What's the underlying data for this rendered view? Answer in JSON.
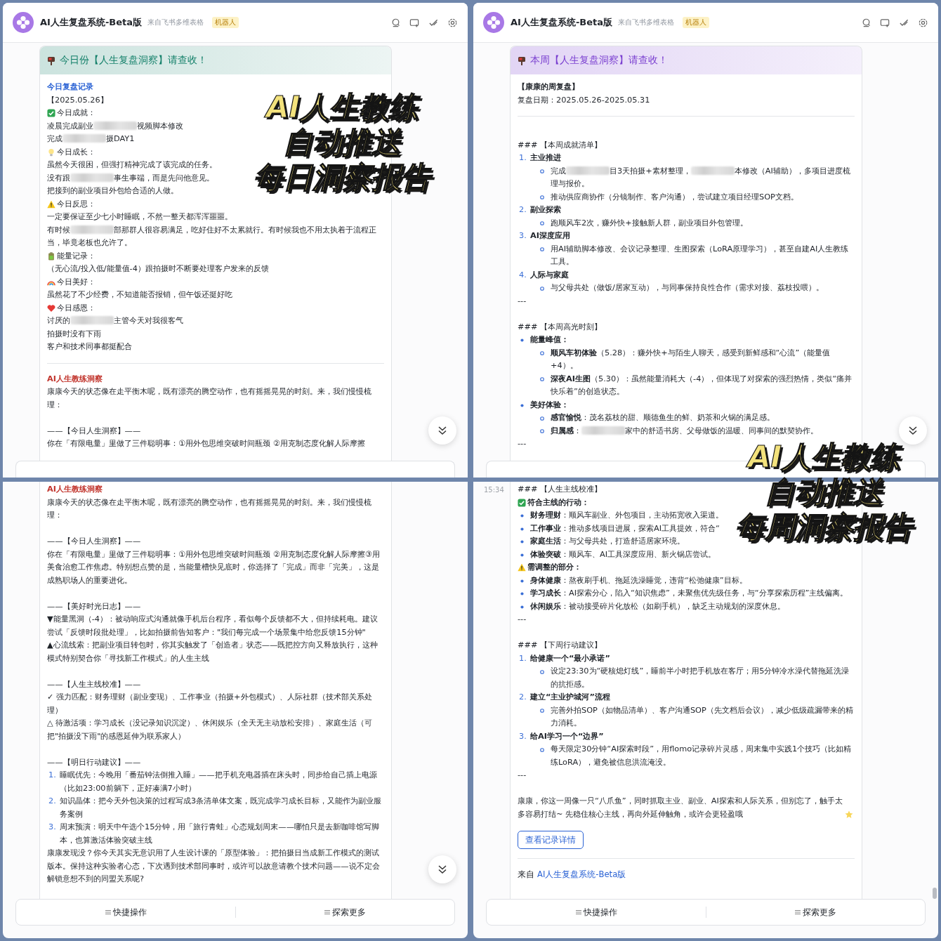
{
  "overlays": [
    {
      "lines": [
        "AI人生教练",
        "自动推送",
        "每日洞察报告"
      ]
    },
    {
      "lines": [
        "AI人生教练",
        "自动推送",
        "每周洞察报告"
      ]
    }
  ],
  "panels": [
    {
      "header": {
        "title": "AI人生复盘系统-Beta版",
        "source": "来自飞书多维表格",
        "badge": "机器人"
      },
      "card": {
        "title": "今日份【人生复盘洞察】请查收！",
        "color": "#14806a",
        "blocks": [
          {
            "kind": "section",
            "color": "#2a62d4",
            "text": "今日复盘记录"
          },
          {
            "kind": "text",
            "text": "【2025.05.26】"
          },
          {
            "kind": "check_label",
            "emphasis": false,
            "text": "今日成就："
          },
          {
            "kind": "text",
            "parts": [
              "凌晨完成副业",
              "视频脚本修改"
            ]
          },
          {
            "kind": "text",
            "parts": [
              "完成",
              "摄DAY1"
            ]
          },
          {
            "kind": "bulb_label",
            "emphasis": false,
            "text": "今日成长："
          },
          {
            "kind": "text",
            "text": "虽然今天很困，但强打精神完成了该完成的任务。"
          },
          {
            "kind": "text",
            "parts": [
              "没有跟",
              "事生事端，而是先问他意见。"
            ]
          },
          {
            "kind": "text",
            "text": "把接到的副业项目外包给合适的人做。"
          },
          {
            "kind": "warn_label",
            "emphasis": false,
            "text": "今日反思："
          },
          {
            "kind": "text",
            "text": "一定要保证至少七小时睡眠，不然一整天都浑浑噩噩。"
          },
          {
            "kind": "text",
            "parts": [
              "有时候",
              "部那群人很容易满足，吃好住好不太累就行。有时候我也不用太执着于流程正当，毕竟老板也允许了。"
            ]
          },
          {
            "kind": "battery_label",
            "emphasis": false,
            "text": "能量记录："
          },
          {
            "kind": "text",
            "text": "（无心流/投入低/能量值-4）跟拍摄时不断要处理客户发来的反馈"
          },
          {
            "kind": "rainbow_label",
            "emphasis": false,
            "text": "今日美好："
          },
          {
            "kind": "text",
            "text": "虽然花了不少经费，不知道能否报销，但午饭还挺好吃"
          },
          {
            "kind": "heart_label",
            "emphasis": false,
            "text": "今日感恩："
          },
          {
            "kind": "text",
            "parts": [
              "讨厌的",
              "主管今天对我很客气"
            ]
          },
          {
            "kind": "text",
            "text": "拍摄时没有下雨"
          },
          {
            "kind": "text",
            "text": "客户和技术同事都挺配合"
          },
          {
            "kind": "rule"
          },
          {
            "kind": "section",
            "color": "#c1332b",
            "text": "AI人生教练洞察"
          },
          {
            "kind": "text",
            "text": "康康今天的状态像在走平衡木呢，既有漂亮的腾空动作，也有摇摇晃晃的时刻。来，我们慢慢梳理："
          },
          {
            "kind": "blank"
          },
          {
            "kind": "text",
            "text": "——【今日人生洞察】——"
          },
          {
            "kind": "text",
            "text": "你在「有限电量」里做了三件聪明事：①用外包思维突破时间瓶颈 ②用克制态度化解人际摩擦"
          }
        ]
      },
      "scroll_down_button": true,
      "scrollbar": false,
      "bottom_bar": {
        "kind": "partial"
      }
    },
    {
      "header": {
        "title": "AI人生复盘系统-Beta版",
        "source": "来自飞书多维表格",
        "badge": "机器人"
      },
      "card": {
        "title": "本周【人生复盘洞察】请查收！",
        "color": "#7a3fd0",
        "blocks": [
          {
            "kind": "strong",
            "text": "【康康的周复盘】"
          },
          {
            "kind": "text",
            "text": "复盘日期：2025.05.26-2025.05.31"
          },
          {
            "kind": "rule"
          },
          {
            "kind": "blank"
          },
          {
            "kind": "text",
            "text": "### 【本周成就清单】"
          },
          {
            "kind": "numbered",
            "num": "1.",
            "emphasis": true,
            "text": "主业推进",
            "children": [
              {
                "parts": [
                  "完成",
                  "目3天拍摄+素材整理，",
                  "本修改（AI辅助），多项目进度梳理与报价。"
                ]
              },
              {
                "text": "推动供应商协作（分镜制作、客户沟通），尝试建立项目经理SOP文档。"
              }
            ]
          },
          {
            "kind": "numbered",
            "num": "2.",
            "emphasis": true,
            "text": "副业探索",
            "children": [
              {
                "text": "跑顺风车2次，赚外快+接触新人群，副业项目外包管理。"
              }
            ]
          },
          {
            "kind": "numbered",
            "num": "3.",
            "emphasis": true,
            "text": "AI深度应用",
            "children": [
              {
                "text": "用AI辅助脚本修改、会议记录整理、生图探索（LoRA原理学习），甚至自建AI人生教练工具。"
              }
            ]
          },
          {
            "kind": "numbered",
            "num": "4.",
            "emphasis": true,
            "text": "人际与家庭",
            "children": [
              {
                "text": "与父母共处（做饭/居家互动），与同事保持良性合作（需求对接、荔枝投喂）。"
              }
            ]
          },
          {
            "kind": "text",
            "text": "---"
          },
          {
            "kind": "blank"
          },
          {
            "kind": "text",
            "text": "### 【本周高光时刻】"
          },
          {
            "kind": "bullet",
            "emphasis": true,
            "text": "能量峰值：",
            "children": [
              {
                "text": "**顺风车初体验**（5.28）：赚外快+与陌生人聊天，感受到新鲜感和“心流”（能量值+4）。"
              },
              {
                "text": "**深夜AI生图**（5.30）：虽然能量消耗大（-4），但体现了对探索的强烈热情，类似“痛并快乐着”的创造状态。"
              }
            ]
          },
          {
            "kind": "bullet",
            "emphasis": true,
            "text": "美好体验：",
            "children": [
              {
                "text": "**感官愉悦**：茂名荔枝的甜、顺德鱼生的鲜、奶茶和火锅的满足感。"
              },
              {
                "parts": [
                  "**归属感**：",
                  "家中的舒适书房、父母做饭的温暖、同事间的默契协作。"
                ]
              }
            ]
          },
          {
            "kind": "text",
            "text": "---"
          }
        ]
      },
      "scroll_down_button": true,
      "scrollbar": false,
      "bottom_bar": {
        "kind": "partial"
      }
    },
    {
      "card": {
        "blocks": [
          {
            "kind": "section",
            "color": "#c1332b",
            "text": "AI人生教练洞察"
          },
          {
            "kind": "text",
            "text": "康康今天的状态像在走平衡木呢，既有漂亮的腾空动作，也有摇摇晃晃的时刻。来，我们慢慢梳理："
          },
          {
            "kind": "blank"
          },
          {
            "kind": "text",
            "text": "——【今日人生洞察】——"
          },
          {
            "kind": "text",
            "text": "你在「有限电量」里做了三件聪明事：①用外包思维突破时间瓶颈 ②用克制态度化解人际摩擦③用美食治愈工作焦虑。特别想点赞的是，当能量槽快见底时，你选择了「完成」而非「完美」，这是成熟职场人的重要进化。"
          },
          {
            "kind": "blank"
          },
          {
            "kind": "text",
            "text": "——【美好时光日志】——"
          },
          {
            "kind": "text",
            "text": "▼能量黑洞（-4）：被动响应式沟通就像手机后台程序，看似每个反馈都不大，但持续耗电。建议尝试「反馈时段批处理」，比如拍摄前告知客户：\"我们每完成一个场景集中给您反馈15分钟\""
          },
          {
            "kind": "text",
            "text": "▲心流线索：把副业项目转包时，你其实触发了「创造者」状态——既把控方向又释放执行，这种模式特别契合你「寻找新工作模式」的人生主线"
          },
          {
            "kind": "blank"
          },
          {
            "kind": "text",
            "text": "——【人生主线校准】——"
          },
          {
            "kind": "text",
            "text": "✓ 强力匹配：财务理财（副业变现）、工作事业（拍摄+外包模式）、人际社群（技术部关系处理）"
          },
          {
            "kind": "text",
            "text": "△ 待激活项：学习成长（没记录知识沉淀）、休闲娱乐（全天无主动放松安排）、家庭生活（可把\"拍摄没下雨\"的感恩延伸为联系家人）"
          },
          {
            "kind": "blank"
          },
          {
            "kind": "text",
            "text": "——【明日行动建议】——"
          },
          {
            "kind": "numbered",
            "num": "1.",
            "emphasis": false,
            "text": "睡眠优先：今晚用「番茄钟法倒推入睡」——把手机充电器插在床头时，同步给自己插上电源（比如23:00前躺下，正好凑满7小时）"
          },
          {
            "kind": "numbered",
            "num": "2.",
            "emphasis": false,
            "text": "知识晶体：把今天外包决策的过程写成3条清单体文案，既完成学习成长目标，又能作为副业服务案例"
          },
          {
            "kind": "numbered",
            "num": "3.",
            "emphasis": false,
            "text": "周末预演：明天中午选个15分钟，用「旅行青蛙」心态规划周末——哪怕只是去新咖啡馆写脚本，也算激活体验突破主线"
          },
          {
            "kind": "text",
            "text": "康康发现没？你今天其实无意识用了人生设计课的「原型体验」：把拍摄日当成新工作模式的测试版本。保持这种实验者心态，下次遇到技术部同事时，或许可以故意请教个技术问题——说不定会解锁意想不到的同盟关系呢?"
          }
        ]
      },
      "scroll_down_button": true,
      "scrollbar": false,
      "bottom_bar": {
        "kind": "full",
        "buttons": [
          "快捷操作",
          "探索更多"
        ]
      }
    },
    {
      "timestamp": "15:34",
      "card": {
        "blocks": [
          {
            "kind": "text",
            "text": "### 【人生主线校准】"
          },
          {
            "kind": "check_label",
            "emphasis": true,
            "text": "符合主线的行动："
          },
          {
            "kind": "bullet",
            "emphasis": false,
            "text": "**财务理财**：顺风车副业、外包项目，主动拓宽收入渠道。"
          },
          {
            "kind": "bullet",
            "emphasis": false,
            "text": "**工作事业**：推动多线项目进展，探索AI工具提效，符合“"
          },
          {
            "kind": "bullet",
            "emphasis": false,
            "text": "**家庭生活**：与父母共处，打造舒适居家环境。"
          },
          {
            "kind": "bullet",
            "emphasis": false,
            "text": "**体验突破**：顺风车、AI工具深度应用、新火锅店尝试。"
          },
          {
            "kind": "warn_label",
            "emphasis": true,
            "text": "需调整的部分："
          },
          {
            "kind": "bullet",
            "emphasis": false,
            "text": "**身体健康**：熬夜刷手机、拖延洗澡睡觉，违背“松弛健康”目标。"
          },
          {
            "kind": "bullet",
            "emphasis": false,
            "text": "**学习成长**：AI探索分心，陷入“知识焦虑”，未聚焦优先级任务，与“分享探索历程”主线偏离。"
          },
          {
            "kind": "bullet",
            "emphasis": false,
            "text": "**休闲娱乐**：被动接受碎片化放松（如刷手机），缺乏主动规划的深度休息。"
          },
          {
            "kind": "text",
            "text": "---"
          },
          {
            "kind": "blank"
          },
          {
            "kind": "text",
            "text": "### 【下周行动建议】"
          },
          {
            "kind": "numbered",
            "num": "1.",
            "emphasis": true,
            "text": "给健康一个“最小承诺”",
            "children": [
              {
                "text": "设定23:30为“硬核熄灯线”，睡前半小时把手机放在客厅；用5分钟冷水澡代替拖延洗澡的抗拒感。"
              }
            ]
          },
          {
            "kind": "numbered",
            "num": "2.",
            "emphasis": true,
            "text": "建立“主业护城河”流程",
            "children": [
              {
                "text": "完善外拍SOP（如物品清单）、客户沟通SOP（先文档后会议），减少低级疏漏带来的精力消耗。"
              }
            ]
          },
          {
            "kind": "numbered",
            "num": "3.",
            "emphasis": true,
            "text": "给AI学习一个“边界”",
            "children": [
              {
                "text": "每天限定30分钟“AI探索时段”，用flomo记录碎片灵感，周末集中实践1个技巧（比如精练LoRA），避免被信息洪流淹没。"
              }
            ]
          },
          {
            "kind": "text",
            "text": "---"
          },
          {
            "kind": "blank"
          },
          {
            "kind": "star_text",
            "text": "康康，你这一周像一只“八爪鱼”，同时抓取主业、副业、AI探索和人际关系，但别忘了，触手太多容易打结~ 先稳住核心主线，再向外延伸触角，或许会更轻盈哦"
          }
        ],
        "action_button": "查看记录详情",
        "footer": {
          "prefix": "来自",
          "link": "AI人生复盘系统-Beta版"
        }
      },
      "scroll_down_button": false,
      "scrollbar": true,
      "bottom_bar": {
        "kind": "full",
        "buttons": [
          "快捷操作",
          "探索更多"
        ]
      }
    }
  ]
}
